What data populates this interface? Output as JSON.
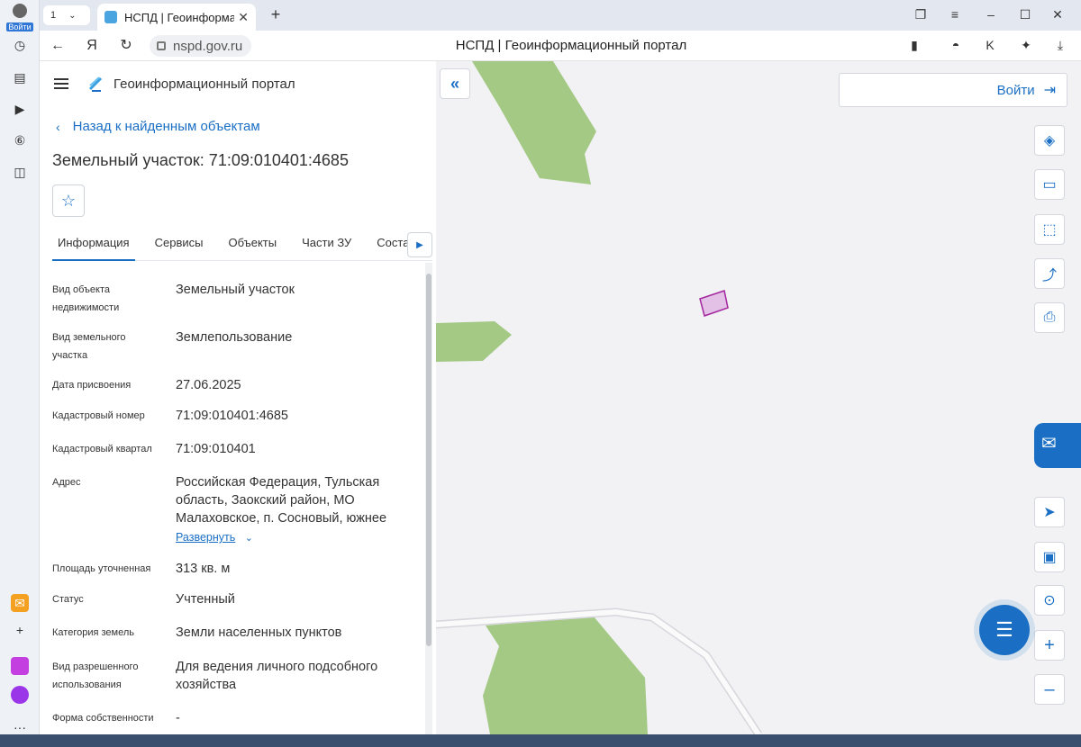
{
  "browser": {
    "login_label": "Войти",
    "tab_count": "1",
    "tab_title": "НСПД | Геоинформац",
    "url": "nspd.gov.ru",
    "page_title": "НСПД | Геоинформационный портал"
  },
  "panel": {
    "portal_name": "Геоинформационный портал",
    "back_link": "Назад к найденным объектам",
    "object_title": "Земельный участок: 71:09:010401:4685",
    "tabs": [
      "Информация",
      "Сервисы",
      "Объекты",
      "Части ЗУ",
      "Состав"
    ],
    "properties": [
      {
        "key": "Вид объекта недвижимости",
        "value": "Земельный участок"
      },
      {
        "key": "Вид земельного участка",
        "value": "Землепользование"
      },
      {
        "key": "Дата присвоения",
        "value": "27.06.2025"
      },
      {
        "key": "Кадастровый номер",
        "value": "71:09:010401:4685"
      },
      {
        "key": "Кадастровый квартал",
        "value": "71:09:010401"
      },
      {
        "key": "Адрес",
        "value": "Российская Федерация, Тульская область, Заокский район, МО Малаховское, п. Сосновый, южнее"
      },
      {
        "key": "Площадь уточненная",
        "value": "313 кв. м"
      },
      {
        "key": "Статус",
        "value": "Учтенный"
      },
      {
        "key": "Категория земель",
        "value": "Земли населенных пунктов"
      },
      {
        "key": "Вид разрешенного использования",
        "value": "Для ведения личного подсобного хозяйства"
      },
      {
        "key": "Форма собственности",
        "value": "-"
      }
    ],
    "expand_label": "Развернуть"
  },
  "map": {
    "login_label": "Войти",
    "controls": [
      "layers-icon",
      "ruler-icon",
      "select-area-icon",
      "share-icon",
      "print-icon",
      "locate-icon",
      "minimap-icon",
      "search-location-icon",
      "zoom-in-icon",
      "zoom-out-icon"
    ],
    "colors": {
      "green": "#a3c984",
      "parcel_fill": "#e3c0e6",
      "parcel_stroke": "#a3279f",
      "accent": "#1a6fc4"
    }
  }
}
